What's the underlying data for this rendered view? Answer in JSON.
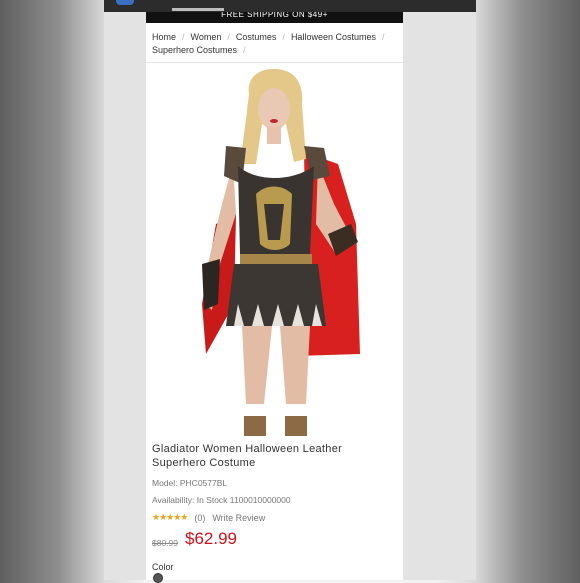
{
  "promo": {
    "text": "FREE SHIPPING ON $49+"
  },
  "breadcrumb": {
    "items": [
      {
        "label": "Home"
      },
      {
        "label": "Women"
      },
      {
        "label": "Costumes"
      },
      {
        "label": "Halloween Costumes"
      },
      {
        "label": "Superhero Costumes"
      }
    ]
  },
  "product": {
    "title": "Gladiator Women Halloween Leather Superhero Costume",
    "model": "Model: PHC0577BL",
    "availability": "Availability: In Stock 1100010000000",
    "stars": "★★★★★",
    "review_count": "(0)",
    "write_review": "Write Review",
    "old_price": "$80.99",
    "price": "$62.99",
    "color_label": "Color"
  },
  "colors": {
    "price_red": "#d0111b",
    "star_gold": "#e8a419",
    "cape_red": "#d8201e"
  }
}
